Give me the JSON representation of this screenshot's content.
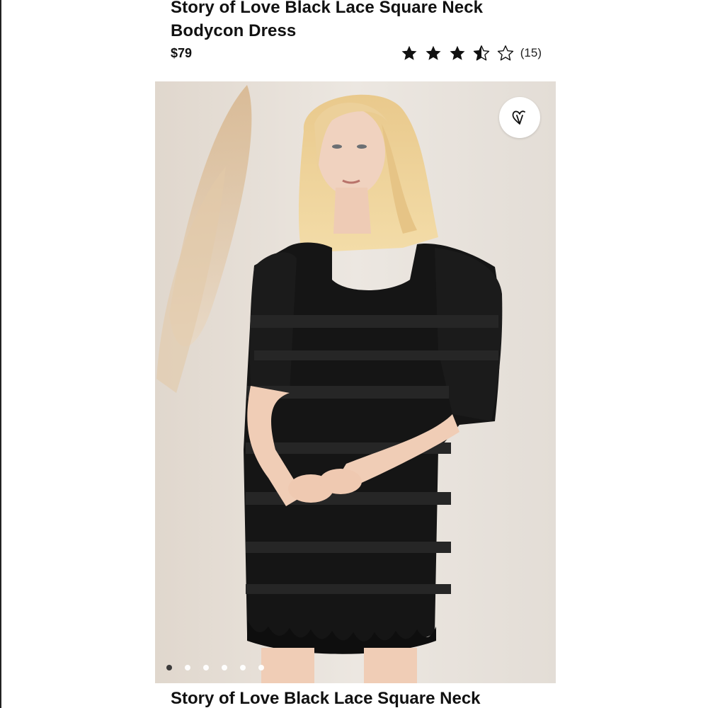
{
  "product": {
    "title_line1": "Story of Love Black Lace Square Neck",
    "title_line2": "Bodycon Dress",
    "price": "$79",
    "rating": {
      "value": 3.5,
      "max": 5,
      "count_label": "(15)"
    },
    "favorite_icon": "heart-icon"
  },
  "gallery": {
    "image_subject": "product-photo",
    "dots_total": 6,
    "active_index": 0
  },
  "footer": {
    "title": "Story of Love Black Lace Square Neck"
  },
  "colors": {
    "text": "#111111",
    "backdrop": "#e9e4de",
    "dress": "#151515",
    "dot_active": "#333333"
  }
}
